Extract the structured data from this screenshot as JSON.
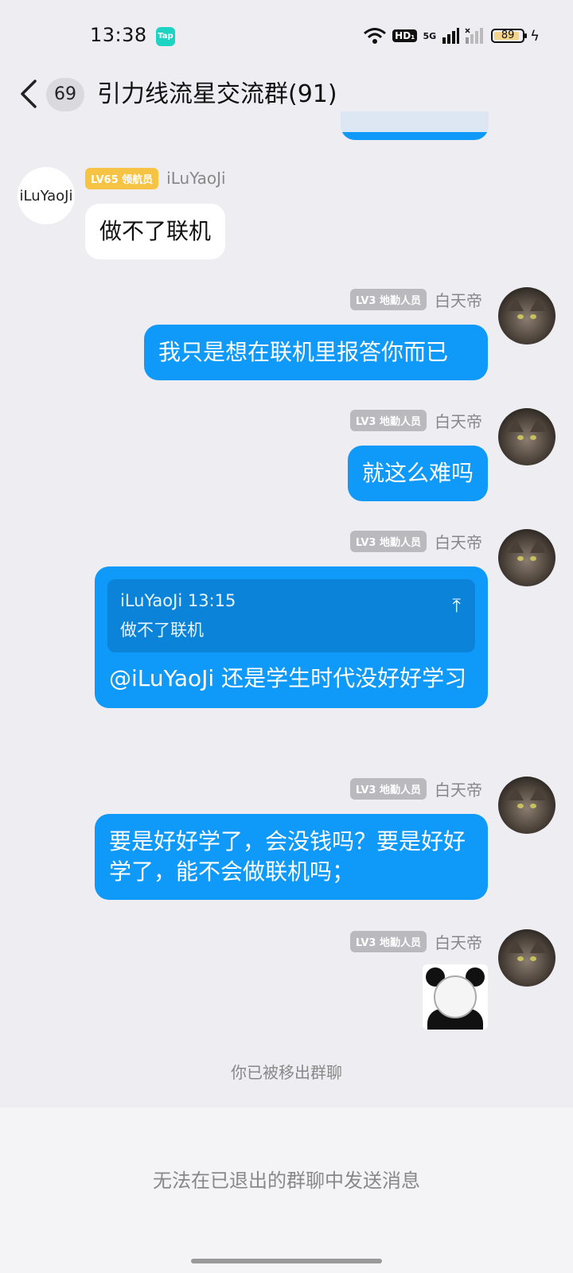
{
  "status_bar": {
    "time": "13:38",
    "app_badge": "Tap",
    "hd": "HD₁",
    "signal": "5G",
    "battery": "89"
  },
  "header": {
    "back_label": "<",
    "unread_count": "69",
    "title": "引力线流星交流群(91)"
  },
  "messages": [
    {
      "sender": "iLuYaoJi",
      "level": "LV65 领航员",
      "avatar_text": "iLuYaoJi",
      "text": "做不了联机"
    },
    {
      "sender": "白天帝",
      "level": "LV3 地勤人员",
      "text": "我只是想在联机里报答你而已"
    },
    {
      "sender": "白天帝",
      "level": "LV3 地勤人员",
      "text": "就这么难吗"
    },
    {
      "sender": "白天帝",
      "level": "LV3 地勤人员",
      "quote": {
        "head": "iLuYaoJi 13:15",
        "body": "做不了联机"
      },
      "text": "@iLuYaoJi 还是学生时代没好好学习"
    },
    {
      "sender": "白天帝",
      "level": "LV3 地勤人员",
      "text": "要是好好学了，会没钱吗？要是好好学了，能不会做联机吗；"
    },
    {
      "sender": "白天帝",
      "level": "LV3 地勤人员",
      "sticker": "panda-meme"
    }
  ],
  "system_notice": "你已被移出群聊",
  "footer": {
    "notice": "无法在已退出的群聊中发送消息"
  },
  "colors": {
    "bubble_blue": "#0f99f8",
    "badge_gold": "#f6c344",
    "badge_gray": "#b9b9be"
  }
}
